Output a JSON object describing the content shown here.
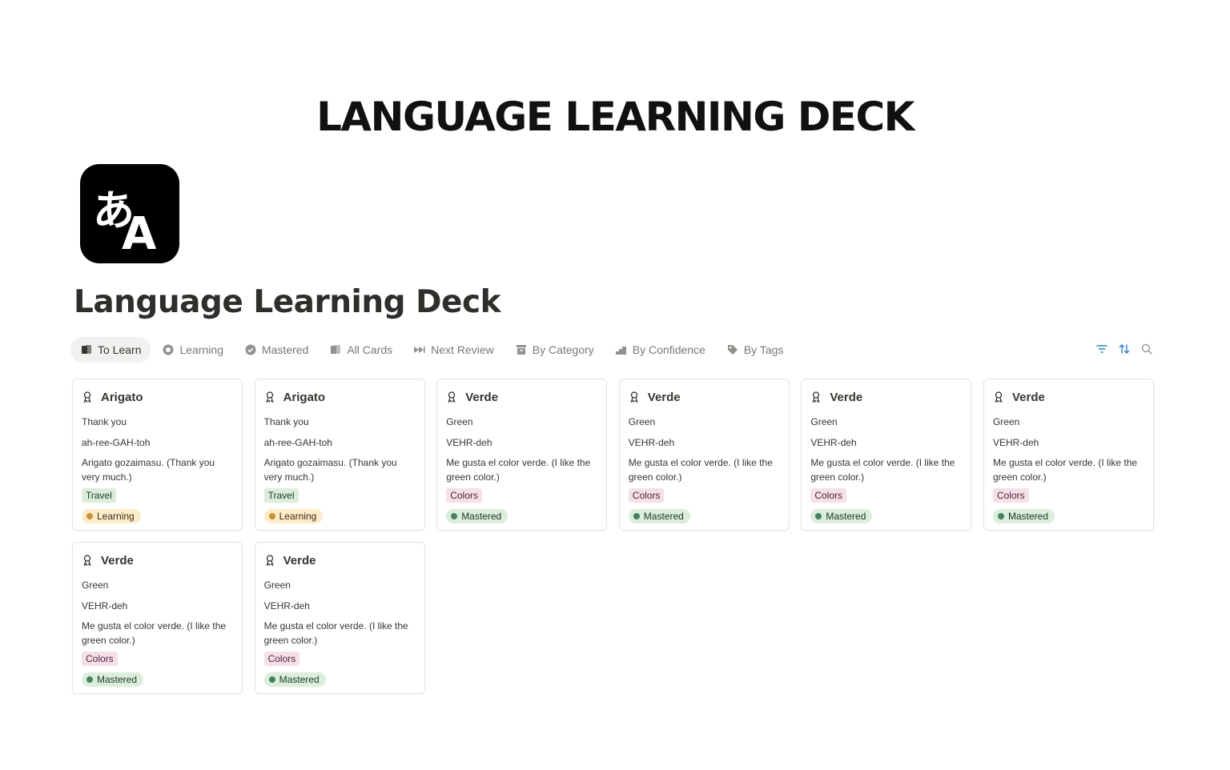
{
  "banner": {
    "title": "LANGUAGE LEARNING DECK"
  },
  "page": {
    "title": "Language Learning Deck",
    "icon": "translate-icon"
  },
  "tabs": [
    {
      "label": "To Learn",
      "icon": "cards-icon",
      "active": true
    },
    {
      "label": "Learning",
      "icon": "circle-dashed-icon",
      "active": false
    },
    {
      "label": "Mastered",
      "icon": "check-circle-icon",
      "active": false
    },
    {
      "label": "All Cards",
      "icon": "cards-icon",
      "active": false
    },
    {
      "label": "Next Review",
      "icon": "fast-forward-icon",
      "active": false
    },
    {
      "label": "By Category",
      "icon": "archive-icon",
      "active": false
    },
    {
      "label": "By Confidence",
      "icon": "bar-steps-icon",
      "active": false
    },
    {
      "label": "By Tags",
      "icon": "tag-icon",
      "active": false
    }
  ],
  "toolbar": {
    "icons": [
      "filter-icon",
      "sort-icon",
      "search-icon"
    ],
    "accent": "#2383e2"
  },
  "cards": [
    {
      "title": "Arigato",
      "meaning": "Thank you",
      "pronunciation": "ah-ree-GAH-toh",
      "example": "Arigato gozaimasu. (Thank you very much.)",
      "tag": "Travel",
      "status": "Learning"
    },
    {
      "title": "Arigato",
      "meaning": "Thank you",
      "pronunciation": "ah-ree-GAH-toh",
      "example": "Arigato gozaimasu. (Thank you very much.)",
      "tag": "Travel",
      "status": "Learning"
    },
    {
      "title": "Verde",
      "meaning": "Green",
      "pronunciation": "VEHR-deh",
      "example": "Me gusta el color verde. (I like the green color.)",
      "tag": "Colors",
      "status": "Mastered"
    },
    {
      "title": "Verde",
      "meaning": "Green",
      "pronunciation": "VEHR-deh",
      "example": "Me gusta el color verde. (I like the green color.)",
      "tag": "Colors",
      "status": "Mastered"
    },
    {
      "title": "Verde",
      "meaning": "Green",
      "pronunciation": "VEHR-deh",
      "example": "Me gusta el color verde. (I like the green color.)",
      "tag": "Colors",
      "status": "Mastered"
    },
    {
      "title": "Verde",
      "meaning": "Green",
      "pronunciation": "VEHR-deh",
      "example": "Me gusta el color verde. (I like the green color.)",
      "tag": "Colors",
      "status": "Mastered"
    },
    {
      "title": "Verde",
      "meaning": "Green",
      "pronunciation": "VEHR-deh",
      "example": "Me gusta el color verde. (I like the green color.)",
      "tag": "Colors",
      "status": "Mastered"
    },
    {
      "title": "Verde",
      "meaning": "Green",
      "pronunciation": "VEHR-deh",
      "example": "Me gusta el color verde. (I like the green color.)",
      "tag": "Colors",
      "status": "Mastered"
    }
  ]
}
